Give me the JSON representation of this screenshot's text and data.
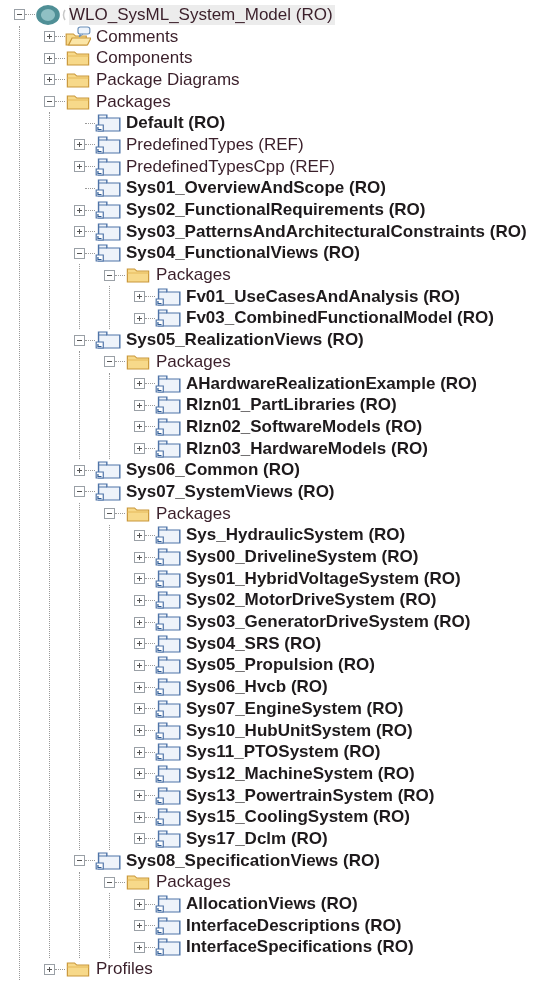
{
  "tree": [
    {
      "label": "WLO_SysML_System_Model (RO)",
      "kind": "root",
      "bold": false,
      "selected": true,
      "expanded": true,
      "children": [
        {
          "label": "Comments",
          "kind": "comments",
          "bold": false,
          "expanded": false
        },
        {
          "label": "Components",
          "kind": "folder",
          "bold": false,
          "expanded": false
        },
        {
          "label": "Package Diagrams",
          "kind": "folder",
          "bold": false,
          "expanded": false
        },
        {
          "label": "Packages",
          "kind": "folder",
          "bold": false,
          "expanded": true,
          "children": [
            {
              "label": "Default (RO)",
              "kind": "package",
              "bold": true
            },
            {
              "label": "PredefinedTypes (REF)",
              "kind": "package",
              "bold": false,
              "expanded": false
            },
            {
              "label": "PredefinedTypesCpp (REF)",
              "kind": "package",
              "bold": false,
              "expanded": false
            },
            {
              "label": "Sys01_OverviewAndScope (RO)",
              "kind": "package",
              "bold": true
            },
            {
              "label": "Sys02_FunctionalRequirements (RO)",
              "kind": "package",
              "bold": true,
              "expanded": false
            },
            {
              "label": "Sys03_PatternsAndArchitecturalConstraints (RO)",
              "kind": "package",
              "bold": true,
              "expanded": false
            },
            {
              "label": "Sys04_FunctionalViews (RO)",
              "kind": "package",
              "bold": true,
              "expanded": true,
              "children": [
                {
                  "label": "Packages",
                  "kind": "folder",
                  "bold": false,
                  "expanded": true,
                  "children": [
                    {
                      "label": "Fv01_UseCasesAndAnalysis (RO)",
                      "kind": "package",
                      "bold": true,
                      "expanded": false
                    },
                    {
                      "label": "Fv03_CombinedFunctionalModel (RO)",
                      "kind": "package",
                      "bold": true,
                      "expanded": false
                    }
                  ]
                }
              ]
            },
            {
              "label": "Sys05_RealizationViews (RO)",
              "kind": "package",
              "bold": true,
              "expanded": true,
              "children": [
                {
                  "label": "Packages",
                  "kind": "folder",
                  "bold": false,
                  "expanded": true,
                  "children": [
                    {
                      "label": "AHardwareRealizationExample (RO)",
                      "kind": "package",
                      "bold": true,
                      "expanded": false
                    },
                    {
                      "label": "Rlzn01_PartLibraries (RO)",
                      "kind": "package",
                      "bold": true,
                      "expanded": false
                    },
                    {
                      "label": "Rlzn02_SoftwareModels (RO)",
                      "kind": "package",
                      "bold": true,
                      "expanded": false
                    },
                    {
                      "label": "Rlzn03_HardwareModels (RO)",
                      "kind": "package",
                      "bold": true,
                      "expanded": false
                    }
                  ]
                }
              ]
            },
            {
              "label": "Sys06_Common (RO)",
              "kind": "package",
              "bold": true,
              "expanded": false
            },
            {
              "label": "Sys07_SystemViews (RO)",
              "kind": "package",
              "bold": true,
              "expanded": true,
              "children": [
                {
                  "label": "Packages",
                  "kind": "folder",
                  "bold": false,
                  "expanded": true,
                  "children": [
                    {
                      "label": "Sys_HydraulicSystem (RO)",
                      "kind": "package",
                      "bold": true,
                      "expanded": false
                    },
                    {
                      "label": "Sys00_DrivelineSystem (RO)",
                      "kind": "package",
                      "bold": true,
                      "expanded": false
                    },
                    {
                      "label": "Sys01_HybridVoltageSystem (RO)",
                      "kind": "package",
                      "bold": true,
                      "expanded": false
                    },
                    {
                      "label": "Sys02_MotorDriveSystem (RO)",
                      "kind": "package",
                      "bold": true,
                      "expanded": false
                    },
                    {
                      "label": "Sys03_GeneratorDriveSystem (RO)",
                      "kind": "package",
                      "bold": true,
                      "expanded": false
                    },
                    {
                      "label": "Sys04_SRS (RO)",
                      "kind": "package",
                      "bold": true,
                      "expanded": false
                    },
                    {
                      "label": "Sys05_Propulsion (RO)",
                      "kind": "package",
                      "bold": true,
                      "expanded": false
                    },
                    {
                      "label": "Sys06_Hvcb (RO)",
                      "kind": "package",
                      "bold": true,
                      "expanded": false
                    },
                    {
                      "label": "Sys07_EngineSystem (RO)",
                      "kind": "package",
                      "bold": true,
                      "expanded": false
                    },
                    {
                      "label": "Sys10_HubUnitSystem (RO)",
                      "kind": "package",
                      "bold": true,
                      "expanded": false
                    },
                    {
                      "label": "Sys11_PTOSystem (RO)",
                      "kind": "package",
                      "bold": true,
                      "expanded": false
                    },
                    {
                      "label": "Sys12_MachineSystem (RO)",
                      "kind": "package",
                      "bold": true,
                      "expanded": false
                    },
                    {
                      "label": "Sys13_PowertrainSystem (RO)",
                      "kind": "package",
                      "bold": true,
                      "expanded": false
                    },
                    {
                      "label": "Sys15_CoolingSystem (RO)",
                      "kind": "package",
                      "bold": true,
                      "expanded": false
                    },
                    {
                      "label": "Sys17_Dclm (RO)",
                      "kind": "package",
                      "bold": true,
                      "expanded": false
                    }
                  ]
                }
              ]
            },
            {
              "label": "Sys08_SpecificationViews (RO)",
              "kind": "package",
              "bold": true,
              "expanded": true,
              "children": [
                {
                  "label": "Packages",
                  "kind": "folder",
                  "bold": false,
                  "expanded": true,
                  "children": [
                    {
                      "label": "AllocationViews (RO)",
                      "kind": "package",
                      "bold": true,
                      "expanded": false
                    },
                    {
                      "label": "InterfaceDescriptions (RO)",
                      "kind": "package",
                      "bold": true,
                      "expanded": false
                    },
                    {
                      "label": "InterfaceSpecifications (RO)",
                      "kind": "package",
                      "bold": true,
                      "expanded": false
                    }
                  ]
                }
              ]
            }
          ]
        },
        {
          "label": "Profiles",
          "kind": "folder",
          "bold": false,
          "expanded": false
        }
      ]
    }
  ]
}
